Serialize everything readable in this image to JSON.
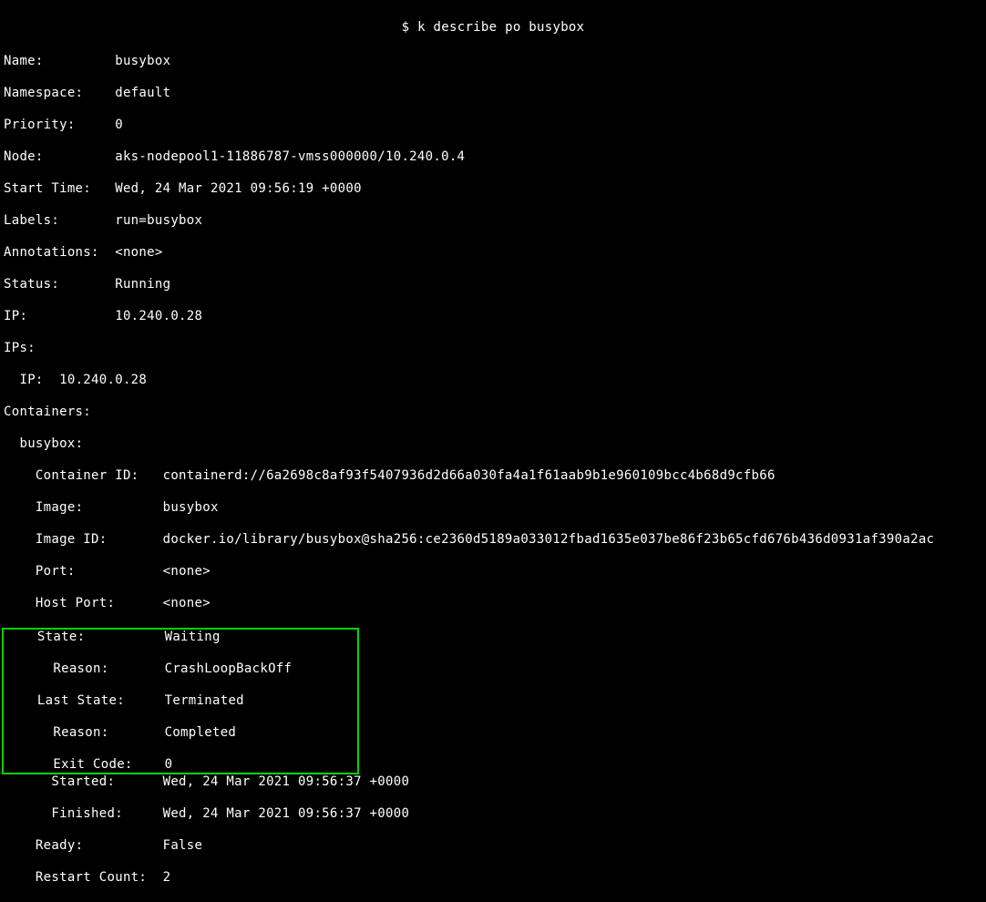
{
  "prompt": {
    "symbol": "$",
    "command": "k describe po busybox"
  },
  "pod": {
    "name_label": "Name:",
    "name": "busybox",
    "namespace_label": "Namespace:",
    "namespace": "default",
    "priority_label": "Priority:",
    "priority": "0",
    "node_label": "Node:",
    "node": "aks-nodepool1-11886787-vmss000000/10.240.0.4",
    "start_time_label": "Start Time:",
    "start_time": "Wed, 24 Mar 2021 09:56:19 +0000",
    "labels_label": "Labels:",
    "labels": "run=busybox",
    "annotations_label": "Annotations:",
    "annotations": "<none>",
    "status_label": "Status:",
    "status": "Running",
    "ip_label": "IP:",
    "ip": "10.240.0.28",
    "ips_label": "IPs:",
    "ips_inner_label": "IP:",
    "ips_inner": "10.240.0.28",
    "containers_label": "Containers:",
    "container_name": "busybox:",
    "container_id_label": "Container ID:",
    "container_id": "containerd://6a2698c8af93f5407936d2d66a030fa4a1f61aab9b1e960109bcc4b68d9cfb66",
    "image_label": "Image:",
    "image": "busybox",
    "image_id_label": "Image ID:",
    "image_id": "docker.io/library/busybox@sha256:ce2360d5189a033012fbad1635e037be86f23b65cfd676b436d0931af390a2ac",
    "port_label": "Port:",
    "port": "<none>",
    "host_port_label": "Host Port:",
    "host_port": "<none>",
    "state_label": "State:",
    "state": "Waiting",
    "state_reason_label": "Reason:",
    "state_reason": "CrashLoopBackOff",
    "last_state_label": "Last State:",
    "last_state": "Terminated",
    "last_state_reason_label": "Reason:",
    "last_state_reason": "Completed",
    "exit_code_label": "Exit Code:",
    "exit_code": "0",
    "started_label": "Started:",
    "started": "Wed, 24 Mar 2021 09:56:37 +0000",
    "finished_label": "Finished:",
    "finished": "Wed, 24 Mar 2021 09:56:37 +0000",
    "ready_label": "Ready:",
    "ready": "False",
    "restart_count_label": "Restart Count:",
    "restart_count": "2"
  }
}
